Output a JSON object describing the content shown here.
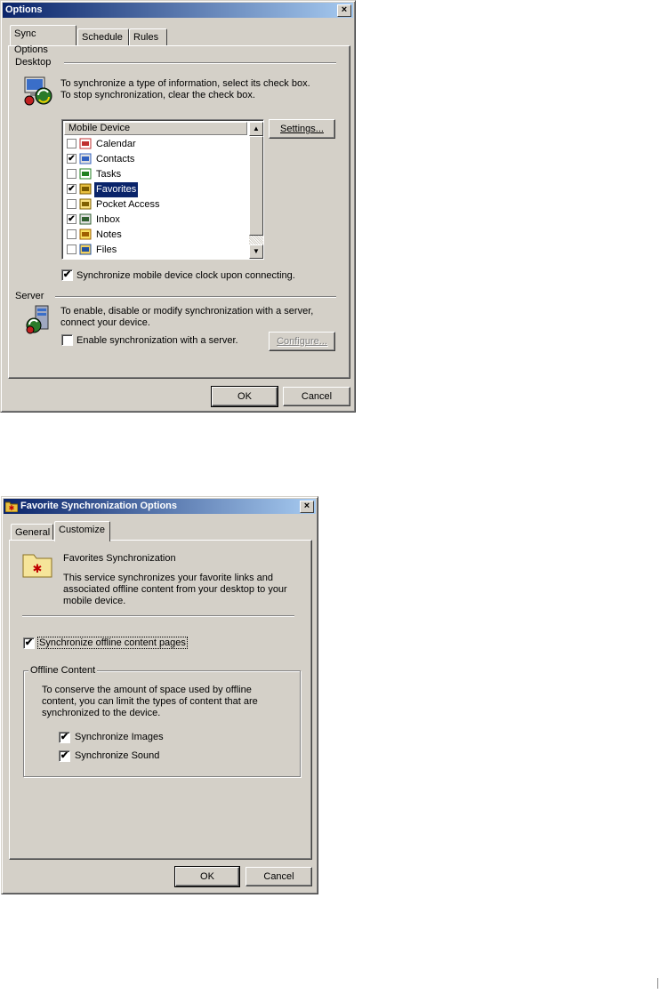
{
  "options_dialog": {
    "title": "Options",
    "close_glyph": "×",
    "tabs": [
      "Sync Options",
      "Schedule",
      "Rules"
    ],
    "desktop": {
      "group_label": "Desktop",
      "desc_line1": "To synchronize a type of information, select its check box.",
      "desc_line2": "To stop synchronization, clear the check box.",
      "icon": "desktop-sync-icon"
    },
    "list": {
      "header": "Mobile Device",
      "items": [
        {
          "label": "Calendar",
          "checked": false,
          "icon": "calendar-icon"
        },
        {
          "label": "Contacts",
          "checked": true,
          "icon": "contacts-icon"
        },
        {
          "label": "Tasks",
          "checked": false,
          "icon": "tasks-icon"
        },
        {
          "label": "Favorites",
          "checked": true,
          "icon": "favorites-icon",
          "selected": true
        },
        {
          "label": "Pocket Access",
          "checked": false,
          "icon": "pocket-access-icon"
        },
        {
          "label": "Inbox",
          "checked": true,
          "icon": "inbox-icon"
        },
        {
          "label": "Notes",
          "checked": false,
          "icon": "notes-icon"
        },
        {
          "label": "Files",
          "checked": false,
          "icon": "files-icon"
        }
      ]
    },
    "settings_btn": "Settings...",
    "clock_cb": {
      "label": "Synchronize mobile device clock upon connecting.",
      "checked": true
    },
    "server": {
      "group_label": "Server",
      "desc_line1": "To enable, disable or modify synchronization with a server,",
      "desc_line2": "connect your device.",
      "enable_cb": {
        "label": "Enable synchronization with a server.",
        "checked": false
      },
      "configure_btn": "Configure..."
    },
    "ok": "OK",
    "cancel": "Cancel"
  },
  "favorites_dialog": {
    "title": "Favorite Synchronization Options",
    "close_glyph": "×",
    "tabs": [
      "General",
      "Customize"
    ],
    "heading": "Favorites Synchronization",
    "desc_line1": "This service synchronizes your favorite links and",
    "desc_line2": "associated offline content from your desktop to your",
    "desc_line3": "mobile device.",
    "sync_offline_cb": {
      "label": "Synchronize offline content pages",
      "checked": true
    },
    "offline_group": {
      "label": "Offline Content",
      "desc_line1": "To conserve the amount of space used by offline",
      "desc_line2": "content, you can limit the types of content that are",
      "desc_line3": "synchronized to the device.",
      "images_cb": {
        "label": "Synchronize Images",
        "checked": true
      },
      "sound_cb": {
        "label": "Synchronize Sound",
        "checked": true
      }
    },
    "ok": "OK",
    "cancel": "Cancel"
  },
  "check_glyph": "✔"
}
